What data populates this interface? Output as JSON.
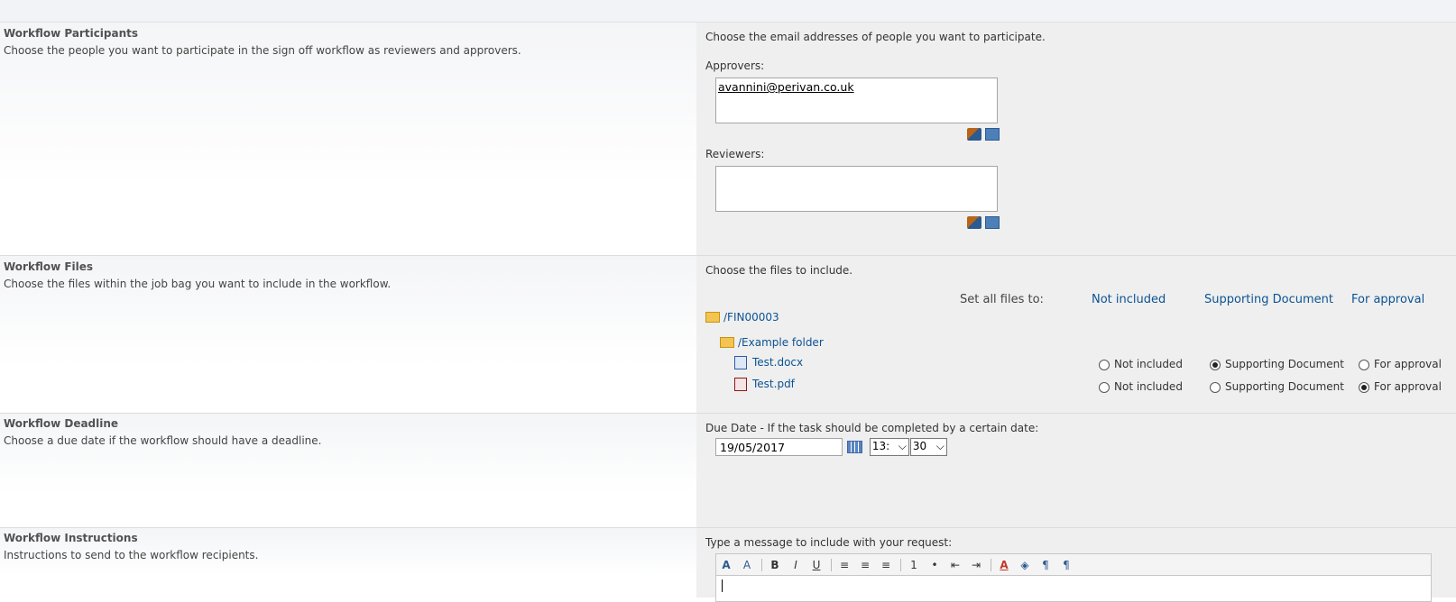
{
  "participants": {
    "title": "Workflow Participants",
    "desc": "Choose the people you want to participate in the sign off workflow as reviewers and approvers.",
    "instruction": "Choose the email addresses of people you want to participate.",
    "approvers_label": "Approvers:",
    "approvers_value": "avannini@perivan.co.uk",
    "reviewers_label": "Reviewers:",
    "reviewers_value": ""
  },
  "files": {
    "title": "Workflow Files",
    "desc": "Choose the files within the job bag you want to include in the workflow.",
    "instruction": "Choose the files to include.",
    "set_all_label": "Set all files to:",
    "set_all_options": [
      "Not included",
      "Supporting Document",
      "For approval"
    ],
    "root_folder": "/FIN00003",
    "sub_folder": "/Example folder",
    "items": [
      {
        "name": "Test.docx",
        "icon": "word-doc-icon",
        "options": [
          "Not included",
          "Supporting Document",
          "For approval"
        ],
        "selected": "Supporting Document"
      },
      {
        "name": "Test.pdf",
        "icon": "pdf-icon",
        "options": [
          "Not included",
          "Supporting Document",
          "For approval"
        ],
        "selected": "For approval"
      }
    ]
  },
  "deadline": {
    "title": "Workflow Deadline",
    "desc": "Choose a due date if the workflow should have a deadline.",
    "instruction": "Due Date - If the task should be completed by a certain date:",
    "date_value": "19/05/2017",
    "hour_value": "13:",
    "minute_value": "30"
  },
  "instructions": {
    "title": "Workflow Instructions",
    "desc": "Instructions to send to the workflow recipients.",
    "instruction": "Type a message to include with your request:",
    "toolbar": [
      "A",
      "A",
      "B",
      "I",
      "U",
      "≡",
      "≡",
      "≡",
      "1",
      "•",
      "⇤",
      "⇥",
      "A",
      "◈",
      "¶",
      "¶"
    ]
  },
  "colors": {
    "link": "#0b5394",
    "panel": "#efefef"
  }
}
